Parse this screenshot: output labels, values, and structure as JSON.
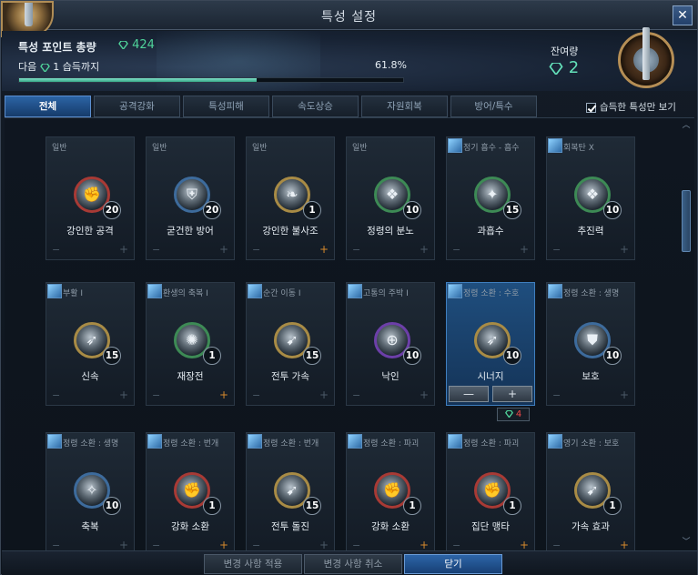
{
  "window": {
    "title": "특성 설정",
    "close_label": "✕"
  },
  "header": {
    "points_label": "특성 포인트 총량",
    "points_value": "424",
    "next_prefix": "다음",
    "next_value": "1",
    "next_suffix": "습득까지",
    "progress_text": "61.8%",
    "progress_fraction": 0.618,
    "remaining_label": "잔여량",
    "remaining_value": "2"
  },
  "tabs": [
    "전체",
    "공격강화",
    "특성피해",
    "속도상승",
    "자원회복",
    "방어/특수"
  ],
  "learned_only_label": "습득한 특성만 보기",
  "cards": [
    {
      "label": "일반",
      "name": "강인한 공격",
      "count": "20",
      "ring": "ring-red",
      "glyph": "✊",
      "plus_active": false
    },
    {
      "label": "일반",
      "name": "굳건한 방어",
      "count": "20",
      "ring": "ring-blue",
      "glyph": "⛨",
      "plus_active": false
    },
    {
      "label": "일반",
      "name": "강인한 불사조",
      "count": "1",
      "ring": "ring-gold",
      "glyph": "❧",
      "plus_active": true
    },
    {
      "label": "일반",
      "name": "정령의 분노",
      "count": "10",
      "ring": "ring-green",
      "glyph": "❖",
      "plus_active": false
    },
    {
      "label": "정기 흡수 - 흡수",
      "name": "과흡수",
      "count": "15",
      "ring": "ring-green",
      "glyph": "✦",
      "plus_active": false
    },
    {
      "label": "회복탄 X",
      "name": "추진력",
      "count": "10",
      "ring": "ring-green",
      "glyph": "❖",
      "plus_active": false
    },
    {
      "label": "부활 I",
      "name": "신속",
      "count": "15",
      "ring": "ring-gold",
      "glyph": "➶",
      "plus_active": false
    },
    {
      "label": "환생의 축복 I",
      "name": "재장전",
      "count": "1",
      "ring": "ring-green",
      "glyph": "✺",
      "plus_active": true
    },
    {
      "label": "순간 이동 I",
      "name": "전투 가속",
      "count": "15",
      "ring": "ring-gold",
      "glyph": "➹",
      "plus_active": false
    },
    {
      "label": "고통의 주박 I",
      "name": "낙인",
      "count": "10",
      "ring": "ring-purple",
      "glyph": "⊕",
      "plus_active": false
    },
    {
      "label": "정령 소환 : 수호",
      "name": "시너지",
      "count": "10",
      "ring": "ring-gold",
      "glyph": "➶",
      "selected": true
    },
    {
      "label": "정령 소환 : 생명",
      "name": "보호",
      "count": "10",
      "ring": "ring-blue",
      "glyph": "⛊",
      "plus_active": false
    },
    {
      "label": "정령 소환 : 생명",
      "name": "축복",
      "count": "10",
      "ring": "ring-blue",
      "glyph": "✧",
      "plus_active": false
    },
    {
      "label": "정령 소환 : 번개",
      "name": "강화 소환",
      "count": "1",
      "ring": "ring-red",
      "glyph": "✊",
      "plus_active": true
    },
    {
      "label": "정령 소환 : 번개",
      "name": "전투 돌진",
      "count": "15",
      "ring": "ring-gold",
      "glyph": "➹",
      "plus_active": false
    },
    {
      "label": "정령 소환 : 파괴",
      "name": "강화 소환",
      "count": "1",
      "ring": "ring-red",
      "glyph": "✊",
      "plus_active": true
    },
    {
      "label": "정령 소환 : 파괴",
      "name": "집단 맹타",
      "count": "1",
      "ring": "ring-red",
      "glyph": "✊",
      "plus_active": true
    },
    {
      "label": "영기 소환 : 보호",
      "name": "가속 효과",
      "count": "1",
      "ring": "ring-gold",
      "glyph": "➹",
      "plus_active": true
    }
  ],
  "selected_card_controls": {
    "minus": "—",
    "plus": "+",
    "cost": "4"
  },
  "footer": {
    "apply": "변경 사항 적용",
    "cancel": "변경 사항 취소",
    "close": "닫기"
  },
  "colors": {
    "accent": "#2c64a5",
    "points": "#4fd39a",
    "cost": "#f04848"
  }
}
